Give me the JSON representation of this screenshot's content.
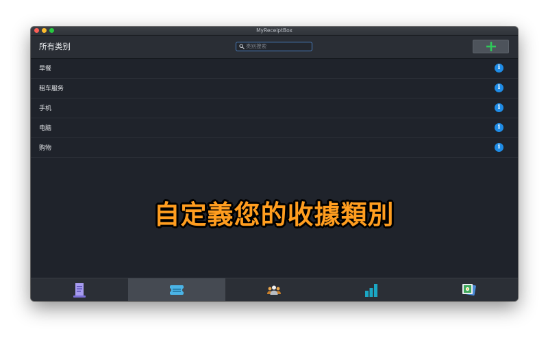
{
  "window": {
    "title": "MyReceiptBox"
  },
  "header": {
    "title": "所有类别",
    "search_placeholder": "类别搜索"
  },
  "categories": [
    {
      "label": "早餐"
    },
    {
      "label": "租车服务"
    },
    {
      "label": "手机"
    },
    {
      "label": "电脑"
    },
    {
      "label": "购物"
    }
  ],
  "caption": "自定義您的收據類別",
  "tabs": [
    {
      "icon": "receipt-icon",
      "active": false
    },
    {
      "icon": "ticket-icon",
      "active": true
    },
    {
      "icon": "people-icon",
      "active": false
    },
    {
      "icon": "bar-chart-icon",
      "active": false
    },
    {
      "icon": "photo-stack-icon",
      "active": false
    }
  ],
  "colors": {
    "background": "#1f232b",
    "accent_blue": "#1f8ce6",
    "add_green": "#2fc85a",
    "caption_orange": "#ff9d1f"
  }
}
